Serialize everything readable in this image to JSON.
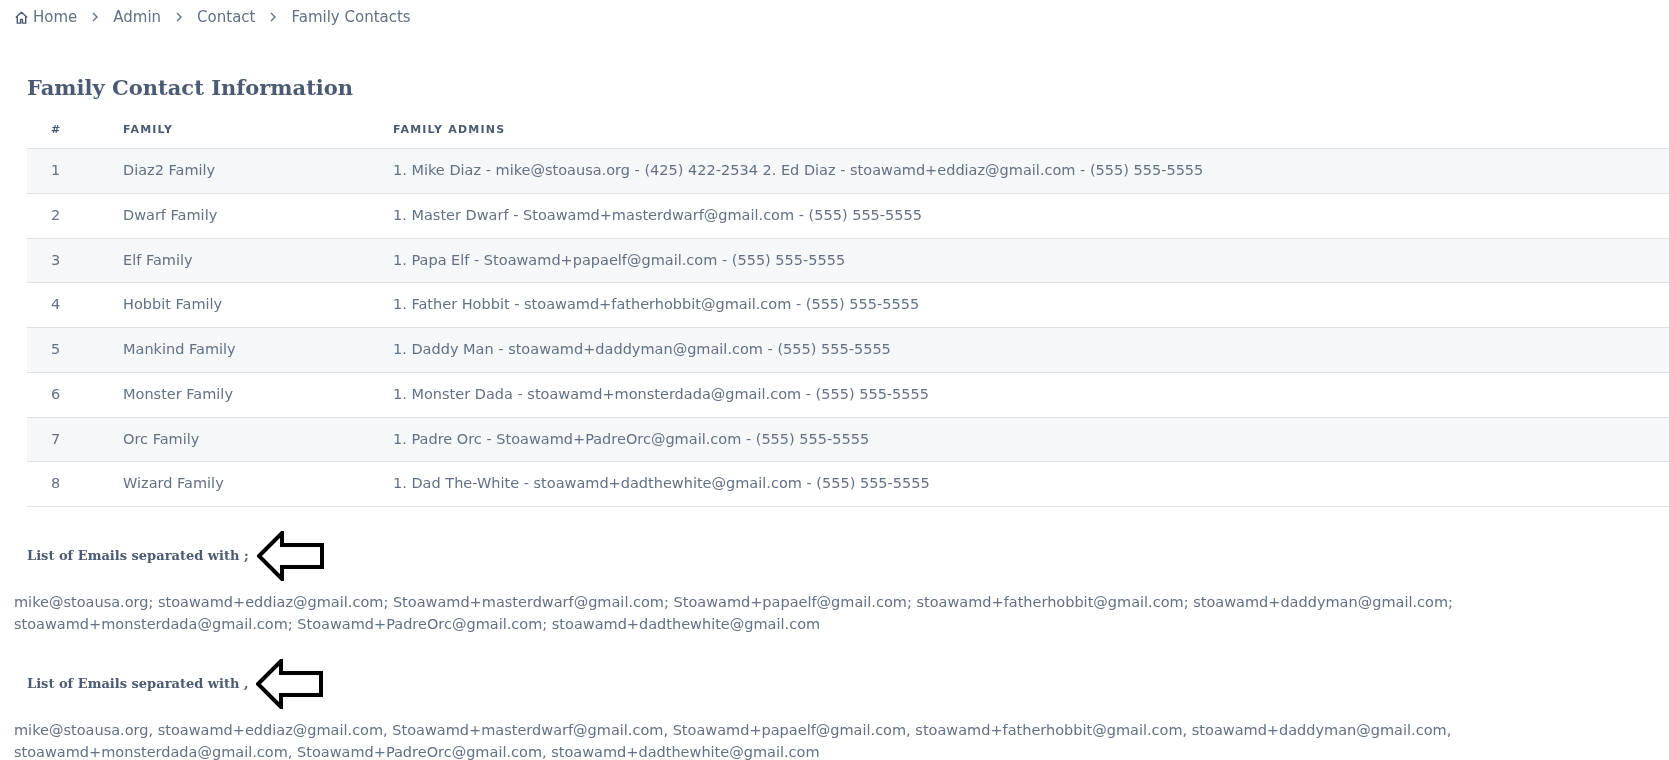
{
  "breadcrumb": [
    {
      "label": "Home",
      "kind": "home"
    },
    {
      "label": "Admin",
      "kind": "link"
    },
    {
      "label": "Contact",
      "kind": "link"
    },
    {
      "label": "Family Contacts",
      "kind": "current"
    }
  ],
  "title": "Family Contact Information",
  "table": {
    "columns": [
      "#",
      "FAMILY",
      "FAMILY ADMINS"
    ],
    "rows": [
      [
        "1",
        "Diaz2 Family",
        "1. Mike Diaz - mike@stoausa.org - (425) 422-2534 2. Ed Diaz - stoawamd+eddiaz@gmail.com - (555) 555-5555"
      ],
      [
        "2",
        "Dwarf Family",
        "1. Master Dwarf - Stoawamd+masterdwarf@gmail.com - (555) 555-5555"
      ],
      [
        "3",
        "Elf Family",
        "1. Papa Elf - Stoawamd+papaelf@gmail.com - (555) 555-5555"
      ],
      [
        "4",
        "Hobbit Family",
        "1. Father Hobbit - stoawamd+fatherhobbit@gmail.com - (555) 555-5555"
      ],
      [
        "5",
        "Mankind Family",
        "1. Daddy Man - stoawamd+daddyman@gmail.com - (555) 555-5555"
      ],
      [
        "6",
        "Monster Family",
        "1. Monster Dada - stoawamd+monsterdada@gmail.com - (555) 555-5555"
      ],
      [
        "7",
        "Orc Family",
        "1. Padre Orc - Stoawamd+PadreOrc@gmail.com - (555) 555-5555"
      ],
      [
        "8",
        "Wizard Family",
        "1. Dad The-White - stoawamd+dadthewhite@gmail.com - (555) 555-5555"
      ]
    ]
  },
  "email_lists": [
    {
      "heading": "List of Emails separated with ;",
      "emails": "mike@stoausa.org; stoawamd+eddiaz@gmail.com; Stoawamd+masterdwarf@gmail.com; Stoawamd+papaelf@gmail.com; stoawamd+fatherhobbit@gmail.com; stoawamd+daddyman@gmail.com; stoawamd+monsterdada@gmail.com; Stoawamd+PadreOrc@gmail.com; stoawamd+dadthewhite@gmail.com"
    },
    {
      "heading": "List of Emails separated with ,",
      "emails": "mike@stoausa.org, stoawamd+eddiaz@gmail.com, Stoawamd+masterdwarf@gmail.com, Stoawamd+papaelf@gmail.com, stoawamd+fatherhobbit@gmail.com, stoawamd+daddyman@gmail.com, stoawamd+monsterdada@gmail.com, Stoawamd+PadreOrc@gmail.com, stoawamd+dadthewhite@gmail.com"
    }
  ]
}
